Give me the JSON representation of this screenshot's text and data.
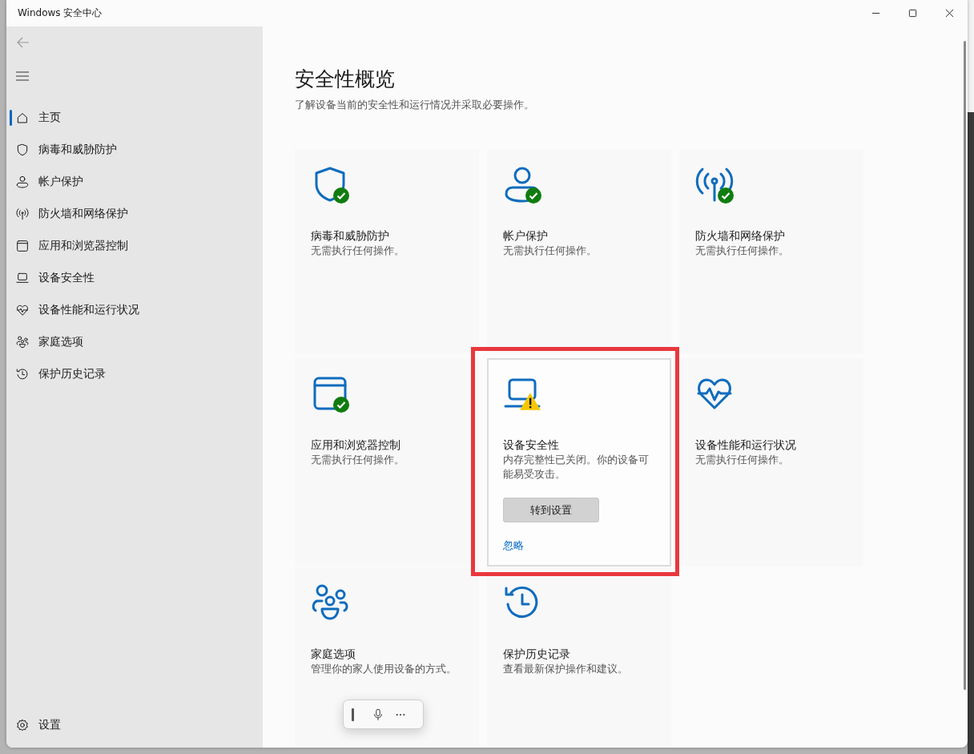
{
  "window": {
    "title": "Windows 安全中心"
  },
  "sidebar": {
    "items": [
      {
        "label": "主页",
        "selected": true
      },
      {
        "label": "病毒和威胁防护",
        "selected": false
      },
      {
        "label": "帐户保护",
        "selected": false
      },
      {
        "label": "防火墙和网络保护",
        "selected": false
      },
      {
        "label": "应用和浏览器控制",
        "selected": false
      },
      {
        "label": "设备安全性",
        "selected": false
      },
      {
        "label": "设备性能和运行状况",
        "selected": false
      },
      {
        "label": "家庭选项",
        "selected": false
      },
      {
        "label": "保护历史记录",
        "selected": false
      }
    ],
    "settings": {
      "label": "设置"
    }
  },
  "page": {
    "title": "安全性概览",
    "subtitle": "了解设备当前的安全性和运行情况并采取必要操作。"
  },
  "cards": [
    {
      "kind": "ok",
      "title": "病毒和威胁防护",
      "description": "无需执行任何操作。"
    },
    {
      "kind": "ok",
      "title": "帐户保护",
      "description": "无需执行任何操作。"
    },
    {
      "kind": "ok",
      "title": "防火墙和网络保护",
      "description": "无需执行任何操作。"
    },
    {
      "kind": "ok",
      "title": "应用和浏览器控制",
      "description": "无需执行任何操作。"
    },
    {
      "kind": "warning",
      "title": "设备安全性",
      "description": "内存完整性已关闭。你的设备可能易受攻击。",
      "button": "转到设置",
      "link": "忽略",
      "highlighted": true
    },
    {
      "kind": "plain",
      "title": "设备性能和运行状况",
      "description": "无需执行任何操作。"
    },
    {
      "kind": "plain",
      "title": "家庭选项",
      "description": "管理你的家人使用设备的方式。"
    },
    {
      "kind": "plain",
      "title": "保护历史记录",
      "description": "查看最新保护操作和建议。"
    }
  ]
}
